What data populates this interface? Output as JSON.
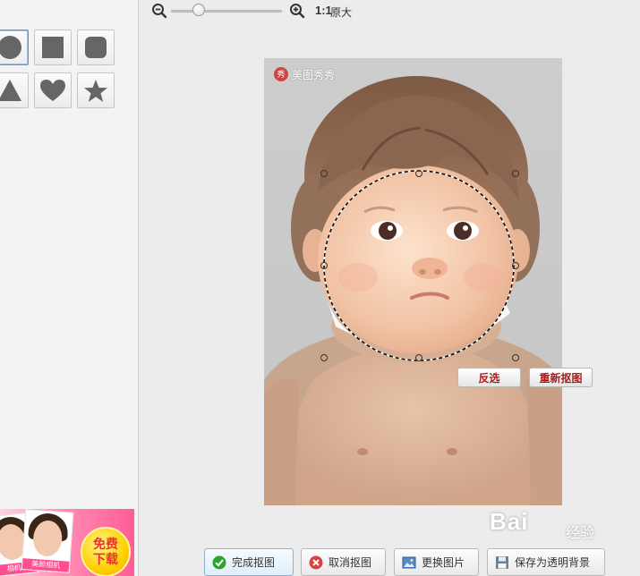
{
  "toolbar": {
    "zoom_out_icon": "zoom-out-icon",
    "zoom_in_icon": "zoom-in-icon",
    "zoom_slider_value": 0.25,
    "ratio_label": "1:1",
    "original_size_label": "原大"
  },
  "shapes": [
    {
      "name": "circle",
      "selected": true
    },
    {
      "name": "square",
      "selected": false
    },
    {
      "name": "rounded-square",
      "selected": false
    },
    {
      "name": "triangle",
      "selected": false
    },
    {
      "name": "heart",
      "selected": false
    },
    {
      "name": "star",
      "selected": false
    }
  ],
  "ad": {
    "caption_left": "相机",
    "caption_right": "美颜相机",
    "free_line1": "免费",
    "free_line2": "下载"
  },
  "canvas": {
    "watermark_logo": "秀",
    "watermark_text": "美图秀秀"
  },
  "context_buttons": {
    "invert_label": "反选",
    "recut_label": "重新抠图"
  },
  "bottom_buttons": {
    "finish_label": "完成抠图",
    "cancel_label": "取消抠图",
    "replace_label": "更换图片",
    "save_label": "保存为透明背景"
  },
  "watermark": {
    "brand": "Bai",
    "brand_suffix": "经验"
  },
  "colors": {
    "accent_red": "#b21818",
    "check_green": "#2aa52a",
    "cancel_red": "#d94040"
  }
}
